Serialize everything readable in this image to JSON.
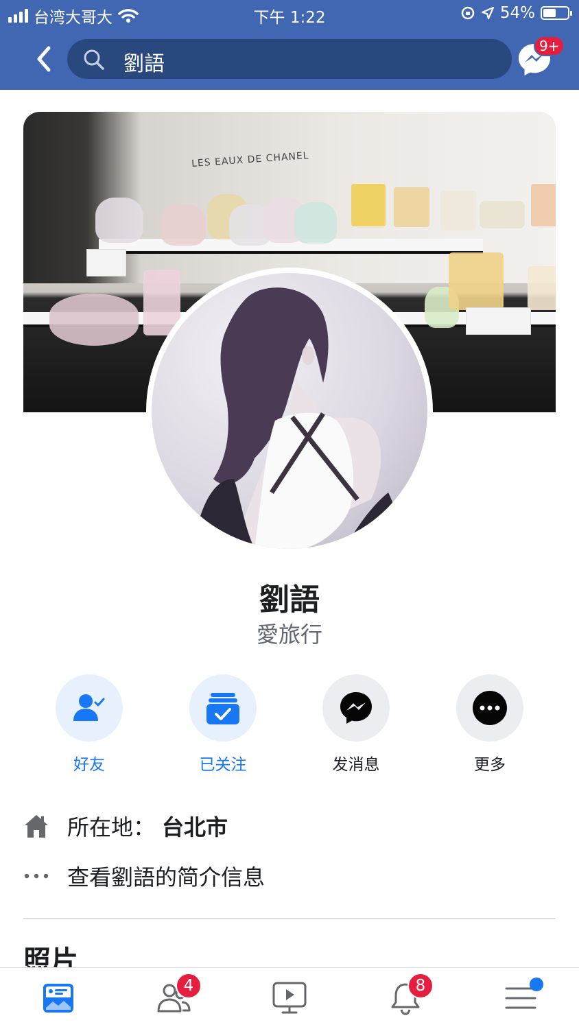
{
  "status_bar": {
    "carrier": "台湾大哥大",
    "time": "下午 1:22",
    "battery": "54%",
    "battery_level": 0.54
  },
  "header": {
    "search_text": "劉語",
    "messenger_badge": "9+",
    "accent_color": "#4267b2"
  },
  "cover": {
    "brand_text": "LES EAUX DE CHANEL"
  },
  "profile": {
    "name": "劉語",
    "bio": "愛旅行"
  },
  "actions": [
    {
      "label": "好友",
      "icon": "friends-check-icon"
    },
    {
      "label": "已关注",
      "icon": "following-icon"
    },
    {
      "label": "发消息",
      "icon": "messenger-icon"
    },
    {
      "label": "更多",
      "icon": "more-icon"
    }
  ],
  "info": {
    "location_label": "所在地：",
    "location_value": "台北市",
    "about_link": "查看劉語的简介信息"
  },
  "sections": {
    "photos_title": "照片"
  },
  "tab_bar": {
    "tabs": [
      "news-feed-icon",
      "friends-icon",
      "watch-icon",
      "notifications-icon",
      "menu-icon"
    ],
    "friends_badge": "4",
    "notifications_badge": "8"
  }
}
